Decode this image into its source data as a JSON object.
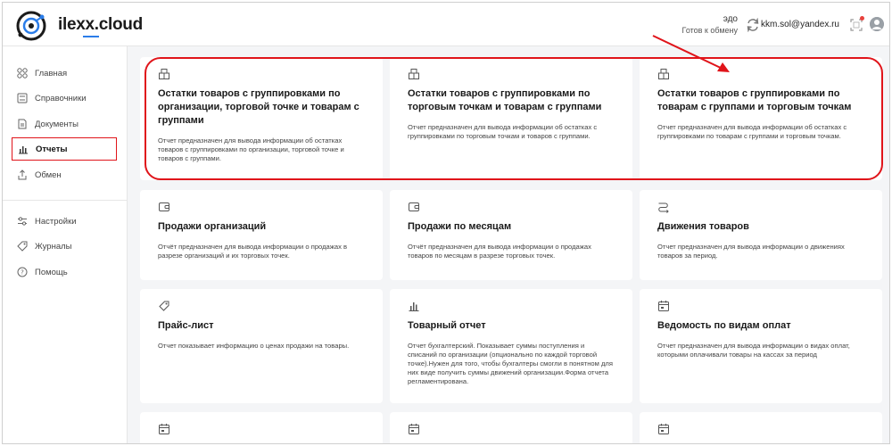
{
  "header": {
    "brand": "ilexx.cloud",
    "edo_title": "эдо",
    "edo_status": "Готов к обмену",
    "user_email": "kkm.sol@yandex.ru"
  },
  "sidebar": {
    "items": [
      {
        "label": "Главная",
        "icon": "grid-icon"
      },
      {
        "label": "Справочники",
        "icon": "book-icon"
      },
      {
        "label": "Документы",
        "icon": "document-icon"
      },
      {
        "label": "Отчеты",
        "icon": "bar-chart-icon",
        "active": true
      },
      {
        "label": "Обмен",
        "icon": "upload-icon"
      },
      {
        "label": "Настройки",
        "icon": "sliders-icon"
      },
      {
        "label": "Журналы",
        "icon": "tag-icon"
      },
      {
        "label": "Помощь",
        "icon": "help-icon"
      }
    ]
  },
  "cards": [
    {
      "icon": "box-icon",
      "title": "Остатки товаров с группировками по организации, торговой точке и товарам с группами",
      "desc": "Отчет предназначен для вывода информации об остатках товаров с группировками по организации, торговой точке и товаров с группами."
    },
    {
      "icon": "box-icon",
      "title": "Остатки товаров с группировками по торговым точкам и товарам с группами",
      "desc": "Отчет предназначен для вывода информации об остатках с группировками по торговым точкам и товаров с группами."
    },
    {
      "icon": "box-icon",
      "title": "Остатки товаров с группировками по товарам с группами и торговым точкам",
      "desc": "Отчет предназначен для вывода информации об остатках с группировками по товарам с группами и торговым точкам."
    },
    {
      "icon": "wallet-icon",
      "title": "Продажи организаций",
      "desc": "Отчёт предназначен для вывода информации о продажах в разрезе организаций и их торговых точек."
    },
    {
      "icon": "wallet-icon",
      "title": "Продажи по месяцам",
      "desc": "Отчёт предназначен для вывода информации о продажах товаров по месяцам в разрезе торговых точек."
    },
    {
      "icon": "route-icon",
      "title": "Движения товаров",
      "desc": "Отчет предназначен для вывода информации о движениях товаров за период."
    },
    {
      "icon": "price-tag-icon",
      "title": "Прайс-лист",
      "desc": "Отчет показывает информацию о ценах продажи на товары."
    },
    {
      "icon": "bar-chart-icon",
      "title": "Товарный отчет",
      "desc": "Отчет бухгалтерский. Показывает суммы поступления и списаний по организации (опционально по каждой торговой точке).Нужен для того, чтобы бухгалтеры смогли в понятном для них виде получить суммы движений организации.Форма отчета регламентирована."
    },
    {
      "icon": "calendar-icon",
      "title": "Ведомость по видам оплат",
      "desc": "Отчет предназначен для вывода информации о видах оплат, которыми оплачивали товары на кассах за период"
    },
    {
      "icon": "calendar-icon",
      "title": "",
      "desc": ""
    },
    {
      "icon": "calendar-icon",
      "title": "",
      "desc": ""
    },
    {
      "icon": "calendar-icon",
      "title": "",
      "desc": ""
    }
  ],
  "colors": {
    "accent": "#2b7de9",
    "highlight": "#e0141a",
    "background": "#f4f5f7"
  }
}
